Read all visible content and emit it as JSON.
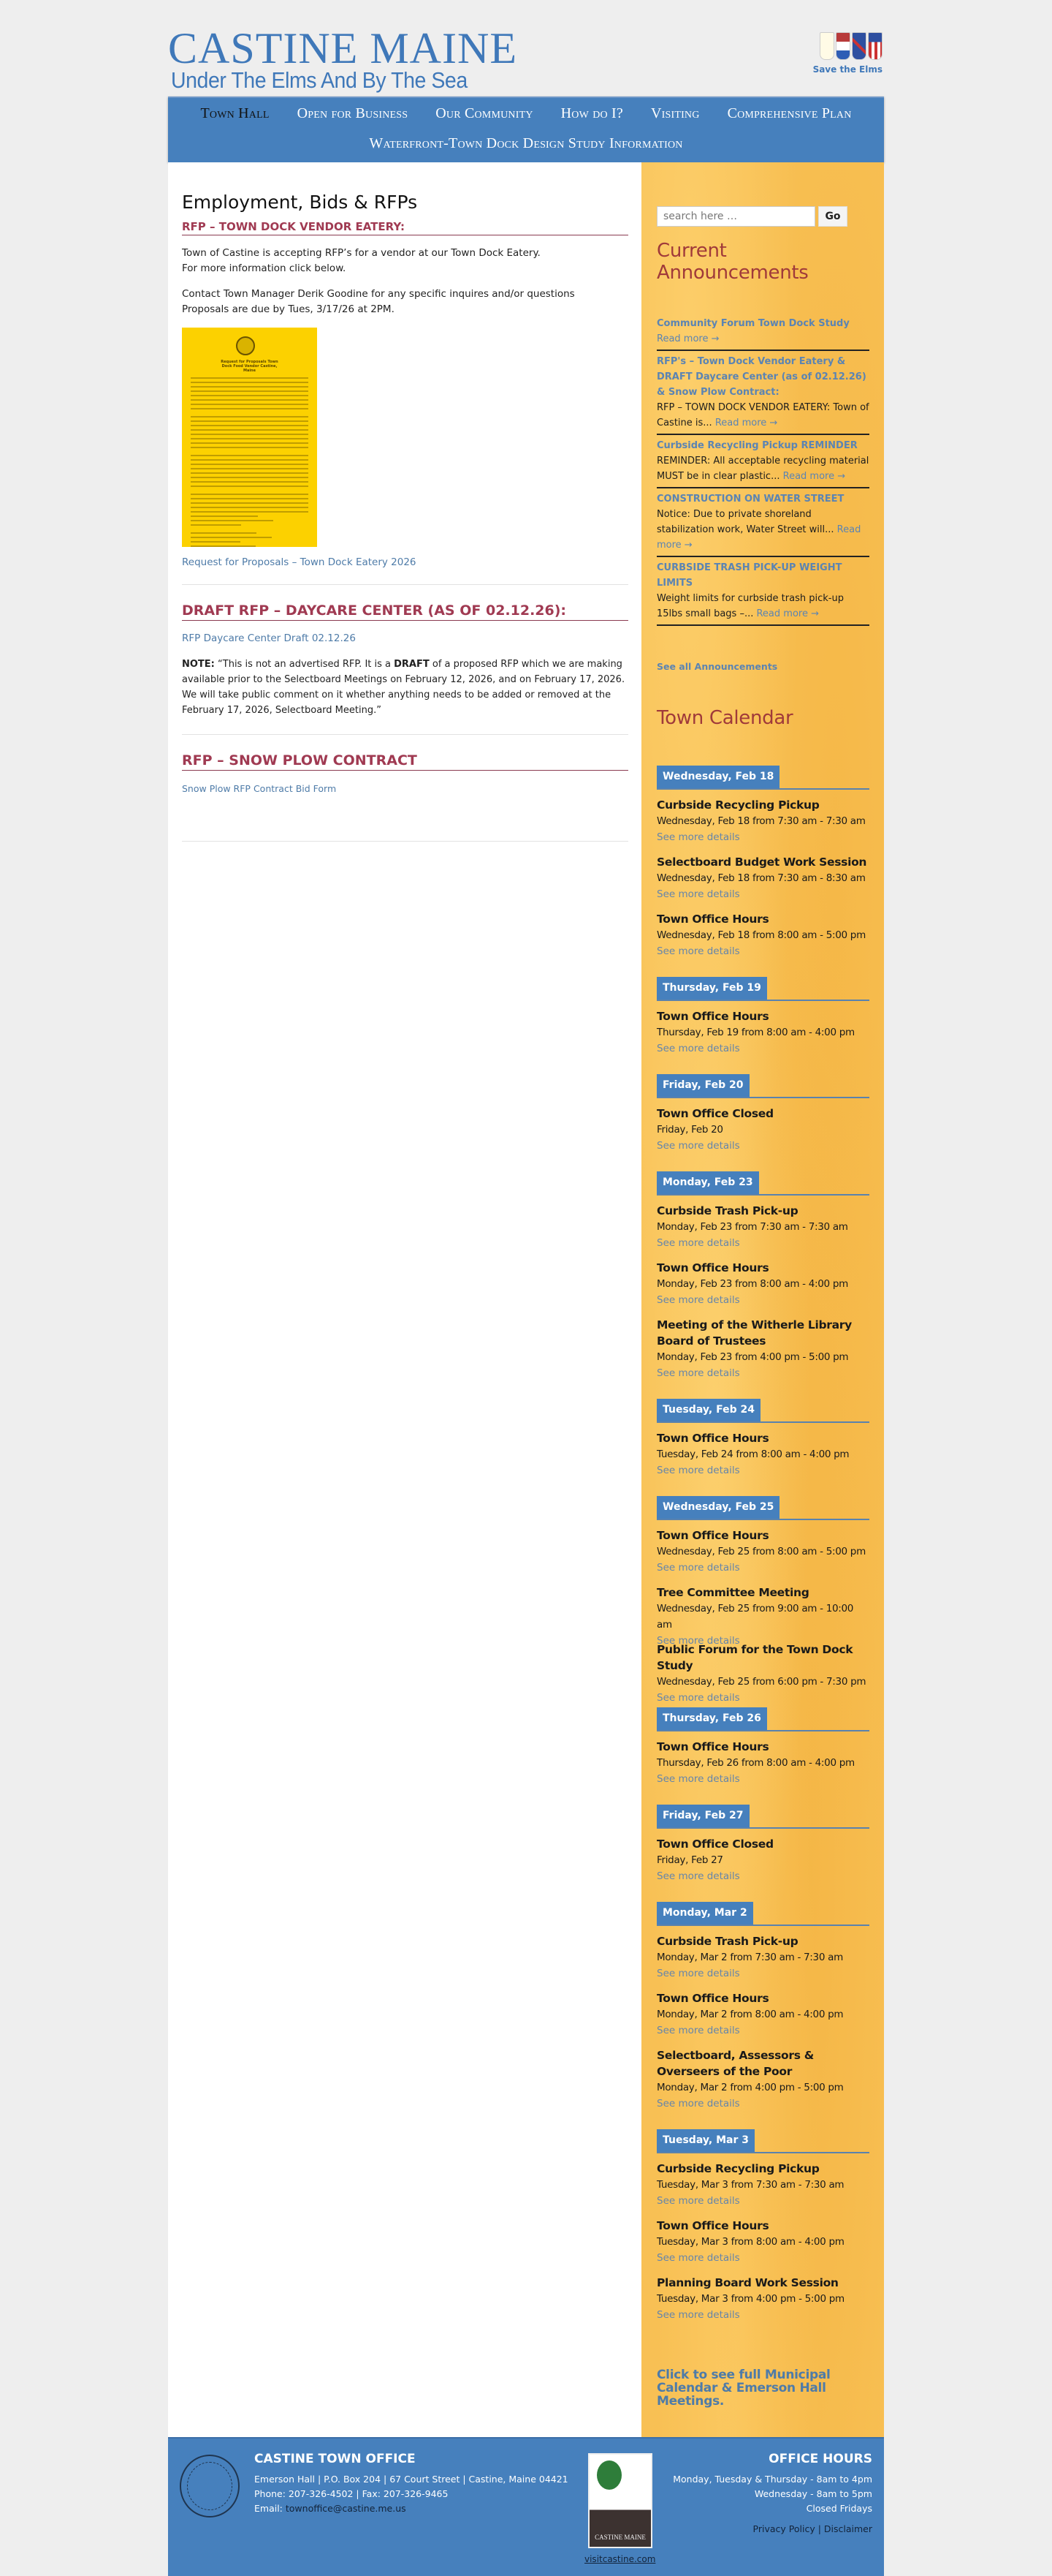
{
  "header": {
    "site_title": "CASTINE MAINE",
    "tagline": "Under The Elms And By The Sea",
    "save_elms": "Save the Elms"
  },
  "nav": {
    "items": [
      "Town Hall",
      "Open for Business",
      "Our Community",
      "How do I?",
      "Visiting",
      "Comprehensive Plan"
    ],
    "second_row": "Waterfront-Town Dock Design Study Information",
    "active": "Town Hall"
  },
  "main": {
    "title": "Employment, Bids & RFPs",
    "sections": [
      {
        "heading": "RFP – TOWN DOCK VENDOR EATERY:",
        "p1a": "Town of Castine is accepting RFP’s for a vendor at our Town Dock Eatery.",
        "p1b": "For more information click below.",
        "p2a": "Contact Town Manager Derik Goodine for any specific inquires and/or questions",
        "p2b": "Proposals are due by Tues, 3/17/26 at 2PM.",
        "image_caption": "Request for Proposals Town Dock Food Vendor Castine, Maine",
        "link": "Request for Proposals – Town Dock Eatery 2026"
      },
      {
        "heading": "DRAFT RFP – DAYCARE CENTER (AS OF 02.12.26):",
        "link": "RFP Daycare Center Draft 02.12.26",
        "note_label": "NOTE:",
        "note_a": " “This is not an advertised RFP. It is a ",
        "note_bold": "DRAFT",
        "note_b": " of a proposed RFP which we are making available prior to the Selectboard Meetings on February 12, 2026, and on February 17, 2026. We will take public comment on it whether anything needs to be added or removed at the February 17, 2026, Selectboard Meeting.”"
      },
      {
        "heading": "RFP – SNOW PLOW CONTRACT",
        "link": "Snow Plow RFP Contract Bid Form"
      }
    ]
  },
  "sidebar": {
    "search_placeholder": "search here …",
    "go_label": "Go",
    "announcements_title": "Current Announcements",
    "announcements": [
      {
        "title": "Community Forum Town Dock Study",
        "excerpt": "",
        "read_more": "Read more →"
      },
      {
        "title": "RFP's – Town Dock Vendor Eatery & DRAFT Daycare Center (as of 02.12.26) & Snow Plow Contract:",
        "excerpt": "RFP – TOWN DOCK VENDOR EATERY: Town of Castine is...",
        "read_more": "Read more →"
      },
      {
        "title": "Curbside Recycling Pickup REMINDER",
        "excerpt": "REMINDER: All acceptable recycling material MUST be in clear plastic...",
        "read_more": "Read more →"
      },
      {
        "title": "CONSTRUCTION ON WATER STREET",
        "excerpt": "Notice: Due to private shoreland stabilization work, Water Street will...",
        "read_more": "Read more →"
      },
      {
        "title": "CURBSIDE TRASH PICK-UP WEIGHT LIMITS",
        "excerpt": "Weight limits for curbside trash pick-up 15lbs small bags –...",
        "read_more": "Read more →"
      }
    ],
    "see_all": "See all Announcements",
    "calendar_title": "Town Calendar",
    "see_more": "See more details",
    "days": [
      {
        "label": "Wednesday, Feb 18",
        "events": [
          {
            "title": "Curbside Recycling Pickup",
            "when": "Wednesday, Feb 18 from 7:30 am - 7:30 am"
          },
          {
            "title": "Selectboard Budget Work Session",
            "when": "Wednesday, Feb 18 from 7:30 am - 8:30 am"
          },
          {
            "title": "Town Office Hours",
            "when": "Wednesday, Feb 18 from 8:00 am - 5:00 pm"
          }
        ]
      },
      {
        "label": "Thursday, Feb 19",
        "events": [
          {
            "title": "Town Office Hours",
            "when": "Thursday, Feb 19 from 8:00 am - 4:00 pm"
          }
        ]
      },
      {
        "label": "Friday, Feb 20",
        "events": [
          {
            "title": "Town Office Closed",
            "when": "Friday, Feb 20"
          }
        ]
      },
      {
        "label": "Monday, Feb 23",
        "events": [
          {
            "title": "Curbside Trash Pick-up",
            "when": "Monday, Feb 23 from 7:30 am - 7:30 am"
          },
          {
            "title": "Town Office Hours",
            "when": "Monday, Feb 23 from 8:00 am - 4:00 pm"
          },
          {
            "title": "Meeting of the Witherle Library Board of Trustees",
            "when": "Monday, Feb 23 from 4:00 pm - 5:00 pm",
            "two": true
          }
        ]
      },
      {
        "label": "Tuesday, Feb 24",
        "events": [
          {
            "title": "Town Office Hours",
            "when": "Tuesday, Feb 24 from 8:00 am - 4:00 pm"
          }
        ]
      },
      {
        "label": "Wednesday, Feb 25",
        "events": [
          {
            "title": "Town Office Hours",
            "when": "Wednesday, Feb 25 from 8:00 am - 5:00 pm"
          },
          {
            "title": "Tree Committee Meeting",
            "when": "Wednesday, Feb 25 from 9:00 am - 10:00 am"
          },
          {
            "title": "Public Forum for the Town Dock Study",
            "when": "Wednesday, Feb 25 from 6:00 pm - 7:30 pm"
          }
        ]
      },
      {
        "label": "Thursday, Feb 26",
        "events": [
          {
            "title": "Town Office Hours",
            "when": "Thursday, Feb 26 from 8:00 am - 4:00 pm"
          }
        ]
      },
      {
        "label": "Friday, Feb 27",
        "events": [
          {
            "title": "Town Office Closed",
            "when": "Friday, Feb 27"
          }
        ]
      },
      {
        "label": "Monday, Mar 2",
        "events": [
          {
            "title": "Curbside Trash Pick-up",
            "when": "Monday, Mar 2 from 7:30 am - 7:30 am"
          },
          {
            "title": "Town Office Hours",
            "when": "Monday, Mar 2 from 8:00 am - 4:00 pm"
          },
          {
            "title": "Selectboard, Assessors & Overseers of the Poor",
            "when": "Monday, Mar 2 from 4:00 pm - 5:00 pm",
            "two": true
          }
        ]
      },
      {
        "label": "Tuesday, Mar 3",
        "events": [
          {
            "title": "Curbside Recycling Pickup",
            "when": "Tuesday, Mar 3 from 7:30 am - 7:30 am"
          },
          {
            "title": "Town Office Hours",
            "when": "Tuesday, Mar 3 from 8:00 am - 4:00 pm"
          },
          {
            "title": "Planning Board Work Session",
            "when": "Tuesday, Mar 3 from 4:00 pm - 5:00 pm"
          }
        ]
      }
    ],
    "full_calendar": "Click to see full Municipal Calendar & Emerson Hall Meetings."
  },
  "footer": {
    "office_title": "CASTINE TOWN OFFICE",
    "address": "Emerson Hall | P.O. Box 204 | 67 Court Street | Castine, Maine 04421",
    "phone": "Phone: 207-326-4502 | Fax: 207-326-9465",
    "email_label": "Email: ",
    "email": "townoffice@castine.me.us",
    "badge_text": "CASTINE MAINE",
    "visit_link": "visitcastine.com",
    "hours_title": "OFFICE HOURS",
    "hours": [
      "Monday, Tuesday & Thursday - 8am to 4pm",
      "Wednesday - 8am to 5pm",
      "Closed Fridays"
    ],
    "privacy": "Privacy Policy",
    "sep": " | ",
    "disclaimer": "Disclaimer"
  },
  "colors": {
    "brand_blue": "#4680bd",
    "heading_red": "#a03a52",
    "sidebar_gold": "#f8c054",
    "link": "#4e7ba8"
  }
}
